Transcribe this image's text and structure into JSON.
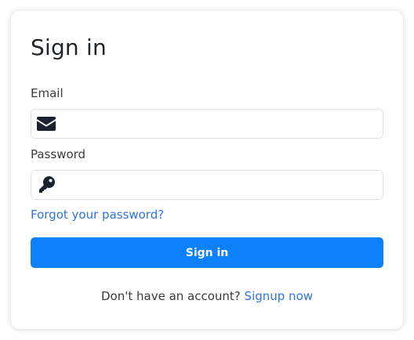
{
  "form": {
    "title": "Sign in",
    "email": {
      "label": "Email",
      "value": "",
      "placeholder": "",
      "icon": "envelope-icon"
    },
    "password": {
      "label": "Password",
      "value": "",
      "placeholder": "",
      "icon": "key-icon"
    },
    "forgot_link": "Forgot your password?",
    "submit_label": "Sign in",
    "footer_text": "Don't have an account?",
    "signup_link": "Signup now"
  },
  "colors": {
    "primary_button": "#0d80fb",
    "link": "#2f73e0",
    "icon": "#1a2230",
    "border": "#dee2e6"
  }
}
